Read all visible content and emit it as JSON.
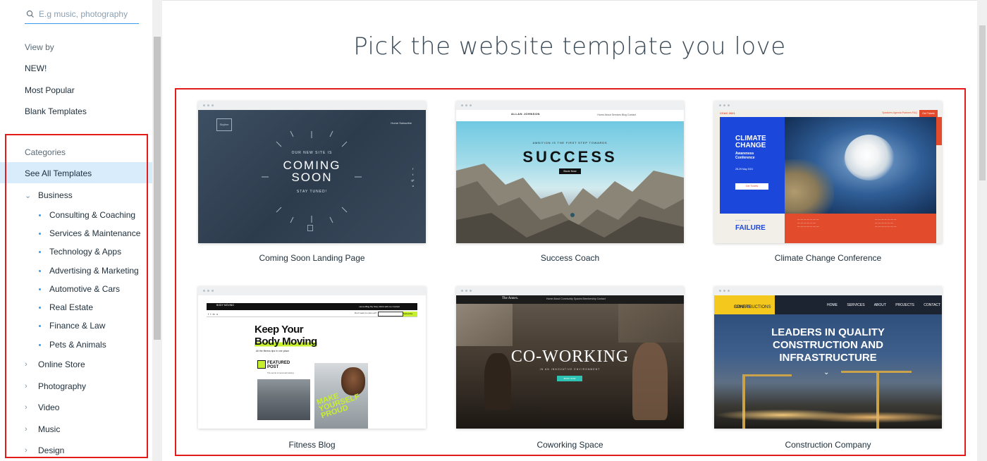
{
  "search": {
    "placeholder": "E.g music, photography"
  },
  "view_by": {
    "title": "View by",
    "items": [
      "NEW!",
      "Most Popular",
      "Blank Templates"
    ]
  },
  "categories": {
    "title": "Categories",
    "selected": "See All Templates",
    "business": {
      "label": "Business",
      "subs": [
        "Consulting & Coaching",
        "Services & Maintenance",
        "Technology & Apps",
        "Advertising & Marketing",
        "Automotive & Cars",
        "Real Estate",
        "Finance & Law",
        "Pets & Animals"
      ]
    },
    "others": [
      "Online Store",
      "Photography",
      "Video",
      "Music",
      "Design"
    ]
  },
  "main": {
    "headline": "Pick the website template you love"
  },
  "templates": [
    {
      "name": "Coming Soon Landing Page",
      "screen": {
        "logo": "Skyline",
        "nav": "Home   Subscribe",
        "line1": "OUR NEW SITE IS",
        "line2": "COMING",
        "line3": "SOON",
        "line4": "STAY TUNED!"
      }
    },
    {
      "name": "Success Coach",
      "screen": {
        "brand": "ALLAN JOHNSON",
        "nav": "Home  About  Services  Blog  Contact",
        "tagline": "AMBITION IS THE FIRST STEP TOWARDS",
        "title": "SUCCESS",
        "button": "Book Now"
      }
    },
    {
      "name": "Climate Change Conference",
      "screen": {
        "top_left": "CCAC 2021",
        "top_nav": "Speakers   Agenda   Partners   FAQ",
        "cta_top": "Get Tickets",
        "title1": "CLIMATE",
        "title2": "CHANGE",
        "sub1": "Awareness",
        "sub2": "Conference",
        "dates": "28-29 May 2021",
        "button": "Get Tickets",
        "bottom_label": "FAILURE"
      }
    },
    {
      "name": "Fitness Blog",
      "screen": {
        "brand": "BODY MOVING",
        "nav": "Home  Blog  My Story  Work with me  Contact",
        "prompt": "Don't want to miss out?",
        "subscribe": "Subscribe",
        "headline1": "Keep Your",
        "headline2": "Body Moving",
        "tagline": "All the fitness tips in one place",
        "featured1": "FEATURED",
        "featured2": "POST",
        "featured_desc": "The secret of personal training",
        "graffiti": "MAKE YOURSELF PROUD"
      }
    },
    {
      "name": "Coworking Space",
      "screen": {
        "brand": "The Annex.",
        "nav": "Home   About   Community   Spaces   Membership   Contact",
        "title": "CO-WORKING",
        "sub": "IN AN INNOVATIVE ENVIRONMENT",
        "button": "BOOK NOW"
      }
    },
    {
      "name": "Construction Company",
      "screen": {
        "logo1": "SPHERE",
        "logo2": "CONSTRUCTIONS",
        "nav": "HOME SERVICES ABOUT PROJECTS CONTACT",
        "line1": "LEADERS IN QUALITY",
        "line2": "CONSTRUCTION AND",
        "line3": "INFRASTRUCTURE"
      }
    }
  ],
  "colors": {
    "accent": "#3899ec",
    "highlight_box": "#e31b1b",
    "selected_bg": "#d8ecfc"
  }
}
